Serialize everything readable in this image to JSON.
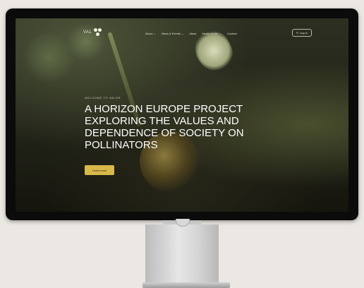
{
  "site": {
    "logo_text": "VAL",
    "nav": [
      "About",
      "News & Events",
      "Ideas",
      "Media center",
      "Contact"
    ],
    "login_label": "Log in",
    "eyebrow": "WELCOME TO VALOR",
    "headline": "A HORIZON EUROPE PROJECT EXPLORING THE VALUES AND DEPENDENCE OF SOCIETY ON POLLINATORS",
    "cta_label": "Learn more"
  },
  "colors": {
    "page_bg": "#ebe7e2",
    "monitor_bezel": "#0b0b0b",
    "cta_yellow": "#d9b84a",
    "headline_text": "#ffffff"
  },
  "icons": {
    "chevron": "chevron-down-icon",
    "login": "user-icon"
  }
}
